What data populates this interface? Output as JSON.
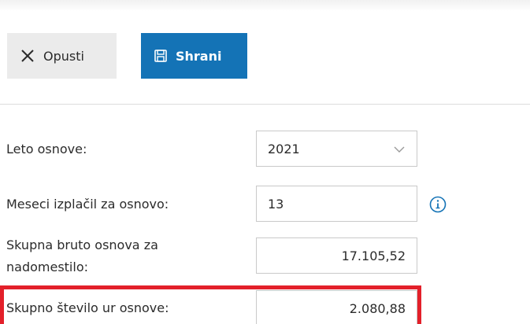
{
  "toolbar": {
    "cancel_label": "Opusti",
    "save_label": "Shrani"
  },
  "form": {
    "base_year": {
      "label": "Leto osnove:",
      "value": "2021"
    },
    "months_paid": {
      "label": "Meseci izplačil za osnovo:",
      "value": "13"
    },
    "gross_base": {
      "label_line1": "Skupna bruto osnova za",
      "label_line2": "nadomestilo:",
      "value": "17.105,52"
    },
    "total_hours": {
      "label": "Skupno število ur osnove:",
      "value": "2.080,88"
    }
  },
  "colors": {
    "accent": "#1473b6",
    "highlight": "#e3202a",
    "cancel_bg": "#ebebeb"
  },
  "icons": {
    "cancel": "close-icon",
    "save": "floppy-disk-icon",
    "select": "chevron-down-icon",
    "info": "info-icon"
  }
}
